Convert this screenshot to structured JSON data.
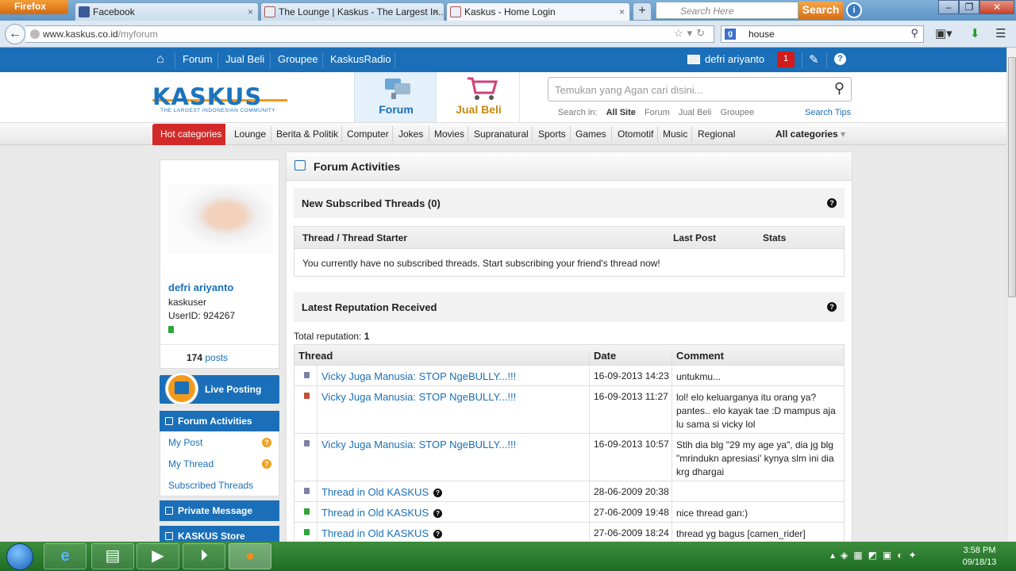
{
  "browser": {
    "app_button": "Firefox",
    "tabs": [
      {
        "title": "Facebook"
      },
      {
        "title": "The Lounge | Kaskus - The Largest In..."
      },
      {
        "title": "Kaskus - Home Login"
      }
    ],
    "new_tab": "+",
    "toolbar_search": {
      "placeholder": "Search Here",
      "button": "Search"
    },
    "url": {
      "host": "www.kaskus.co.id",
      "path": "/myforum"
    },
    "google_search": {
      "value": "house"
    }
  },
  "kaskus": {
    "topnav": [
      "Forum",
      "Jual Beli",
      "Groupee",
      "KaskusRadio"
    ],
    "user": {
      "name": "defri ariyanto",
      "notifications": "1"
    },
    "logo": {
      "text": "KASKUS",
      "tagline": "THE LARGEST INDONESIAN COMMUNITY"
    },
    "main_tabs": [
      "Forum",
      "Jual Beli"
    ],
    "search": {
      "placeholder": "Temukan yang Agan cari disini...",
      "label": "Search in:",
      "options": [
        "All Site",
        "Forum",
        "Jual Beli",
        "Groupee"
      ],
      "tips": "Search Tips"
    },
    "categories": {
      "hot": "Hot categories",
      "items": [
        "Lounge",
        "Berita & Politik",
        "Computer",
        "Jokes",
        "Movies",
        "Supranatural",
        "Sports",
        "Games",
        "Otomotif",
        "Music",
        "Regional"
      ],
      "all": "All categories"
    }
  },
  "sidebar": {
    "profile": {
      "name": "defri ariyanto",
      "role": "kaskuser",
      "user_id": "UserID: 924267",
      "posts_count": "174",
      "posts_label": "posts"
    },
    "live_posting": "Live Posting",
    "forum_activities": "Forum Activities",
    "submenu": [
      {
        "label": "My Post",
        "badge": "?"
      },
      {
        "label": "My Thread",
        "badge": "?"
      },
      {
        "label": "Subscribed Threads",
        "badge": ""
      }
    ],
    "private_message": "Private Message",
    "store": "KASKUS Store"
  },
  "main": {
    "title": "Forum Activities",
    "subscribed": {
      "title": "New Subscribed Threads (0)",
      "columns": [
        "Thread / Thread Starter",
        "Last Post",
        "Stats"
      ],
      "empty_message": "You currently have no subscribed threads. Start subscribing your friend's thread now!"
    },
    "reputation": {
      "title": "Latest Reputation Received",
      "total_label": "Total reputation:",
      "total_value": "1",
      "columns": [
        "Thread",
        "Date",
        "Comment"
      ],
      "rows": [
        {
          "thread": "Vicky Juga Manusia: STOP NgeBULLY...!!!",
          "date": "16-09-2013 14:23",
          "comment": "untukmu...",
          "color": "#7d7fa6",
          "has_q": false
        },
        {
          "thread": "Vicky Juga Manusia: STOP NgeBULLY...!!!",
          "date": "16-09-2013 11:27",
          "comment": "lol! elo keluarganya itu orang ya? pantes.. elo kayak tae :D mampus aja lu sama si vicky lol",
          "color": "#c0503a",
          "has_q": false
        },
        {
          "thread": "Vicky Juga Manusia: STOP NgeBULLY...!!!",
          "date": "16-09-2013 10:57",
          "comment": "Stlh dia blg \"29 my age ya\", dia jg blg \"mrindukn apresiasi' kynya slm ini dia krg dhargai",
          "color": "#7d7fa6",
          "has_q": false
        },
        {
          "thread": "Thread in Old KASKUS",
          "date": "28-06-2009 20:38",
          "comment": "",
          "color": "#7d7fa6",
          "has_q": true
        },
        {
          "thread": "Thread in Old KASKUS",
          "date": "27-06-2009 19:48",
          "comment": "nice thread gan:)",
          "color": "#2fa53a",
          "has_q": true
        },
        {
          "thread": "Thread in Old KASKUS",
          "date": "27-06-2009 18:24",
          "comment": "thread yg bagus [camen_rider]",
          "color": "#2fa53a",
          "has_q": true
        }
      ]
    }
  },
  "taskbar": {
    "time": "3:58 PM",
    "date": "09/18/13"
  }
}
